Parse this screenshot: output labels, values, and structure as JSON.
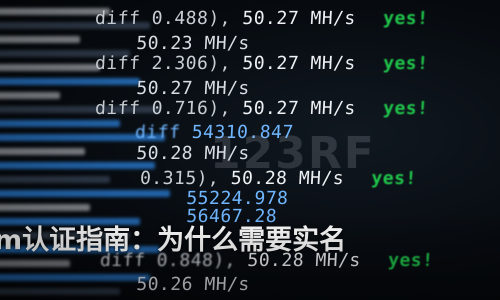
{
  "terminal": {
    "lines": [
      {
        "diff": "diff 0.488),",
        "rate": "50.27 MH/s",
        "status": "yes!"
      },
      {
        "diff": "",
        "rate": "50.23 MH/s",
        "status": ""
      },
      {
        "diff": "diff 2.306),",
        "rate": "50.27 MH/s",
        "status": "yes!"
      },
      {
        "diff": "",
        "rate": "50.27 MH/s",
        "status": ""
      },
      {
        "diff": "diff 0.716),",
        "rate": "50.27 MH/s",
        "status": "yes!"
      },
      {
        "diff": "diff",
        "rate": "54310.847",
        "status": ""
      },
      {
        "diff": "",
        "rate": "50.28 MH/s",
        "status": ""
      },
      {
        "diff": "0.315),",
        "rate": "50.28 MH/s",
        "status": "yes!"
      },
      {
        "diff": "",
        "rate": "55224.978",
        "status": ""
      },
      {
        "diff": "",
        "rate": "56467.28",
        "status": ""
      },
      {
        "diff": "diff 0.848),",
        "rate": "50.28 MH/s",
        "status": "yes!"
      },
      {
        "diff": "",
        "rate": "50.26 MH/s",
        "status": ""
      }
    ]
  },
  "watermark": "123RF",
  "overlay_title": "m认证指南：为什么需要实名",
  "colors": {
    "accept_green": "#1fc44a",
    "accent_blue": "#2a7fd8",
    "background": "#05080c"
  }
}
